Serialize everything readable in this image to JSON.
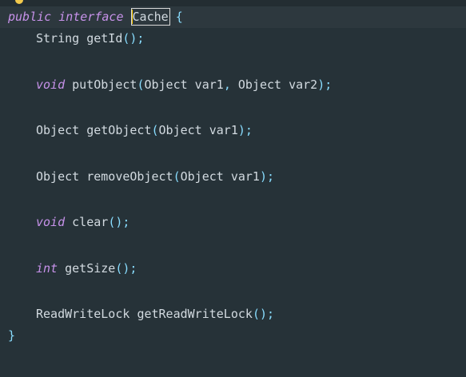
{
  "editor": {
    "language": "java",
    "lines": [
      {
        "tokens": [
          {
            "t": "public",
            "k": "kw"
          },
          {
            "t": " "
          },
          {
            "t": "interface",
            "k": "kw"
          },
          {
            "t": " "
          },
          {
            "t": "Cache",
            "k": "selected"
          },
          {
            "t": " "
          },
          {
            "t": "{",
            "k": "punct"
          }
        ]
      },
      {
        "indent": true,
        "tokens": [
          {
            "t": "String",
            "k": "type"
          },
          {
            "t": " "
          },
          {
            "t": "getId",
            "k": "fn"
          },
          {
            "t": "();",
            "k": "punct"
          }
        ]
      },
      {
        "gap": true
      },
      {
        "indent": true,
        "tokens": [
          {
            "t": "void",
            "k": "kw"
          },
          {
            "t": " "
          },
          {
            "t": "putObject",
            "k": "fn"
          },
          {
            "t": "(",
            "k": "punct"
          },
          {
            "t": "Object var1",
            "k": "type"
          },
          {
            "t": ", ",
            "k": "punct"
          },
          {
            "t": "Object var2",
            "k": "type"
          },
          {
            "t": ");",
            "k": "punct"
          }
        ]
      },
      {
        "gap": true
      },
      {
        "indent": true,
        "tokens": [
          {
            "t": "Object",
            "k": "type"
          },
          {
            "t": " "
          },
          {
            "t": "getObject",
            "k": "fn"
          },
          {
            "t": "(",
            "k": "punct"
          },
          {
            "t": "Object var1",
            "k": "type"
          },
          {
            "t": ");",
            "k": "punct"
          }
        ]
      },
      {
        "gap": true
      },
      {
        "indent": true,
        "tokens": [
          {
            "t": "Object",
            "k": "type"
          },
          {
            "t": " "
          },
          {
            "t": "removeObject",
            "k": "fn"
          },
          {
            "t": "(",
            "k": "punct"
          },
          {
            "t": "Object var1",
            "k": "type"
          },
          {
            "t": ");",
            "k": "punct"
          }
        ]
      },
      {
        "gap": true
      },
      {
        "indent": true,
        "tokens": [
          {
            "t": "void",
            "k": "kw"
          },
          {
            "t": " "
          },
          {
            "t": "clear",
            "k": "fn"
          },
          {
            "t": "();",
            "k": "punct"
          }
        ]
      },
      {
        "gap": true
      },
      {
        "indent": true,
        "tokens": [
          {
            "t": "int",
            "k": "kw"
          },
          {
            "t": " "
          },
          {
            "t": "getSize",
            "k": "fn"
          },
          {
            "t": "();",
            "k": "punct"
          }
        ]
      },
      {
        "gap": true
      },
      {
        "indent": true,
        "tokens": [
          {
            "t": "ReadWriteLock",
            "k": "type"
          },
          {
            "t": " "
          },
          {
            "t": "getReadWriteLock",
            "k": "fn"
          },
          {
            "t": "();",
            "k": "punct"
          }
        ]
      },
      {
        "tokens": [
          {
            "t": "}",
            "k": "punct"
          }
        ]
      }
    ]
  },
  "colors": {
    "background": "#263238",
    "keyword": "#c792ea",
    "text": "#d2dae0",
    "punctuation": "#89ddff",
    "caret": "#ffcc00"
  },
  "icons": {
    "intention": "lightbulb-icon"
  }
}
